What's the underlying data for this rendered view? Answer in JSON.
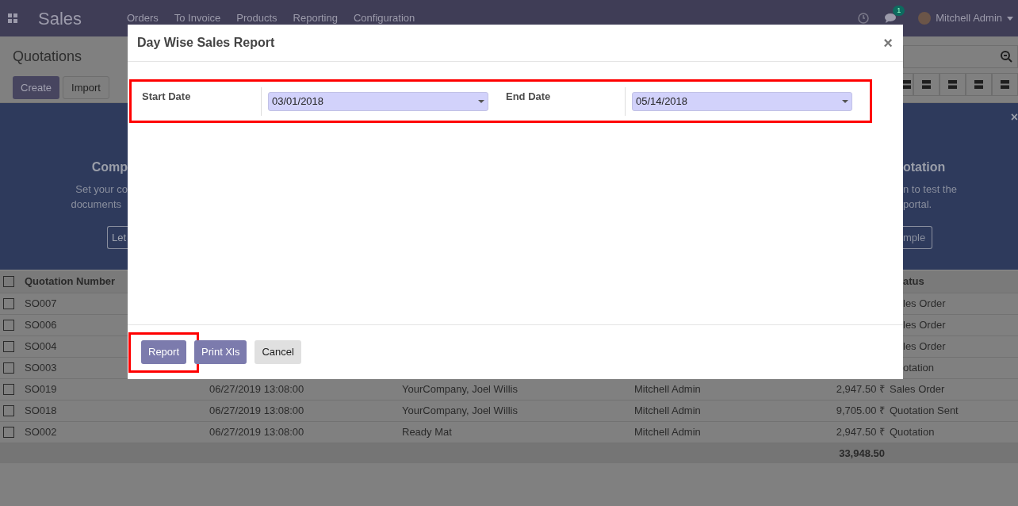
{
  "navbar": {
    "app_title": "Sales",
    "menu": [
      "Orders",
      "To Invoice",
      "Products",
      "Reporting",
      "Configuration"
    ],
    "messages_count": "1",
    "user": "Mitchell Admin"
  },
  "control_panel": {
    "title": "Quotations",
    "buttons": [
      "Create",
      "Import"
    ]
  },
  "banner": {
    "close": "×",
    "left": {
      "title": "Comp",
      "lines": [
        "Set your co",
        "documents"
      ],
      "button": "Let"
    },
    "right": {
      "title": "otation",
      "lines": [
        "n to test the",
        "portal."
      ],
      "button": "mple"
    }
  },
  "table": {
    "header_checked": false,
    "header_left": "Quotation Number",
    "header_right": "atus",
    "rows": [
      {
        "kind": "partial",
        "checked": false,
        "number": "SO007",
        "status": "les Order"
      },
      {
        "kind": "partial",
        "checked": false,
        "number": "SO006",
        "status": "les Order"
      },
      {
        "kind": "partial",
        "checked": false,
        "number": "SO004",
        "status": "les Order"
      },
      {
        "kind": "partial",
        "checked": false,
        "number": "SO003",
        "status": "otation"
      },
      {
        "kind": "full",
        "checked": false,
        "number": "SO019",
        "date": "06/27/2019 13:08:00",
        "customer": "YourCompany, Joel Willis",
        "salesperson": "Mitchell Admin",
        "total": "2,947.50 ₹",
        "status": "Sales Order"
      },
      {
        "kind": "full",
        "checked": false,
        "number": "SO018",
        "date": "06/27/2019 13:08:00",
        "customer": "YourCompany, Joel Willis",
        "salesperson": "Mitchell Admin",
        "total": "9,705.00 ₹",
        "status": "Quotation Sent"
      },
      {
        "kind": "full",
        "checked": false,
        "number": "SO002",
        "date": "06/27/2019 13:08:00",
        "customer": "Ready Mat",
        "salesperson": "Mitchell Admin",
        "total": "2,947.50 ₹",
        "status": "Quotation"
      }
    ],
    "grand_total": "33,948.50"
  },
  "dialog": {
    "title": "Day Wise Sales Report",
    "close": "×",
    "fields_highlighted": true,
    "fields": [
      {
        "label": "Start Date",
        "value": "03/01/2018"
      },
      {
        "label": "End Date",
        "value": "05/14/2018"
      }
    ],
    "buttons": [
      {
        "label": "Report",
        "kind": "primary",
        "highlighted": true
      },
      {
        "label": "Print Xls",
        "kind": "primary",
        "highlighted": false
      },
      {
        "label": "Cancel",
        "kind": "secondary",
        "highlighted": false
      }
    ]
  }
}
